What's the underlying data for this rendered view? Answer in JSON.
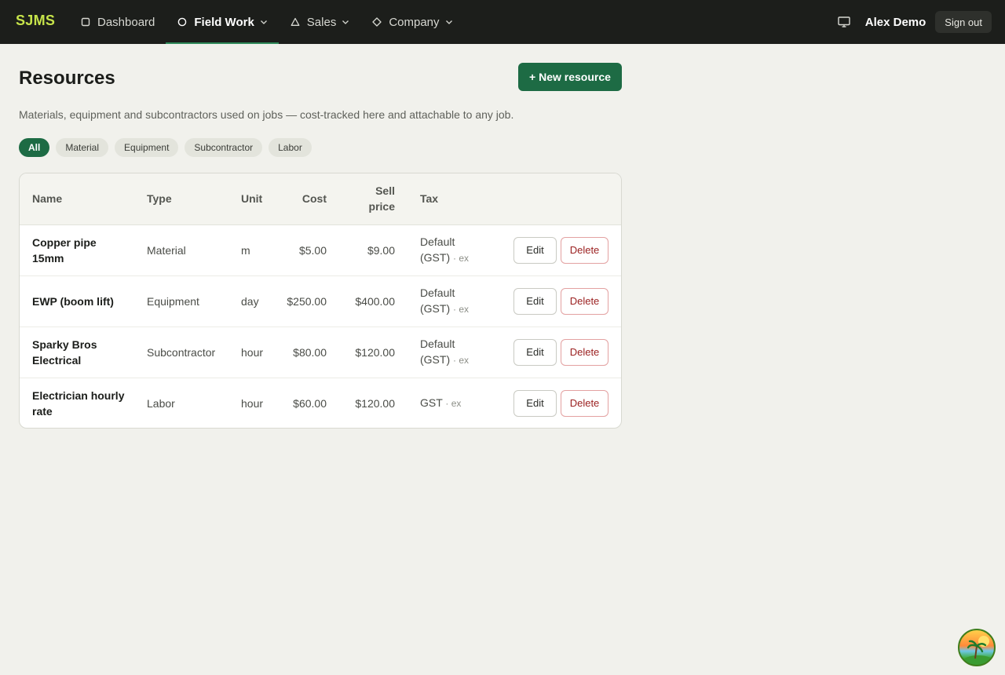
{
  "app": {
    "logo": "SJMS"
  },
  "nav": [
    {
      "label": "Dashboard",
      "icon": "square-icon"
    },
    {
      "label": "Field Work",
      "icon": "circle-icon",
      "active": true
    },
    {
      "label": "Sales",
      "icon": "triangle-icon"
    },
    {
      "label": "Company",
      "icon": "diamond-icon"
    }
  ],
  "user": {
    "name": "Alex Demo",
    "signout_label": "Sign out"
  },
  "page": {
    "title": "Resources",
    "new_button": "+ New resource",
    "subtitle": "Materials, equipment and subcontractors used on jobs — cost-tracked here and attachable to any job."
  },
  "filters": [
    "All",
    "Material",
    "Equipment",
    "Subcontractor",
    "Labor"
  ],
  "table": {
    "headers": {
      "name": "Name",
      "type": "Type",
      "unit": "Unit",
      "cost": "Cost",
      "sell_line1": "Sell",
      "sell_line2": "price",
      "tax": "Tax"
    },
    "edit_label": "Edit",
    "delete_label": "Delete",
    "rows": [
      {
        "name_line1": "Copper pipe",
        "name_line2": "15mm",
        "type": "Material",
        "unit": "m",
        "cost": "$5.00",
        "sell": "$9.00",
        "tax_line1": "Default",
        "tax_line2": "(GST)",
        "tax_suffix": "· ex"
      },
      {
        "name_line1": "EWP (boom lift)",
        "name_line2": "",
        "type": "Equipment",
        "unit": "day",
        "cost": "$250.00",
        "sell": "$400.00",
        "tax_line1": "Default",
        "tax_line2": "(GST)",
        "tax_suffix": "· ex"
      },
      {
        "name_line1": "Sparky Bros",
        "name_line2": "Electrical",
        "type": "Subcontractor",
        "unit": "hour",
        "cost": "$80.00",
        "sell": "$120.00",
        "tax_line1": "Default",
        "tax_line2": "(GST)",
        "tax_suffix": "· ex"
      },
      {
        "name_line1": "Electrician hourly",
        "name_line2": "rate",
        "type": "Labor",
        "unit": "hour",
        "cost": "$60.00",
        "sell": "$120.00",
        "tax_line1": "GST",
        "tax_line2": "",
        "tax_suffix": "· ex"
      }
    ]
  },
  "colors": {
    "accent": "#1d6b44",
    "topbar": "#1c1e1b",
    "logo": "#c6e34a",
    "danger": "#9b2121",
    "background": "#f1f1ec"
  }
}
